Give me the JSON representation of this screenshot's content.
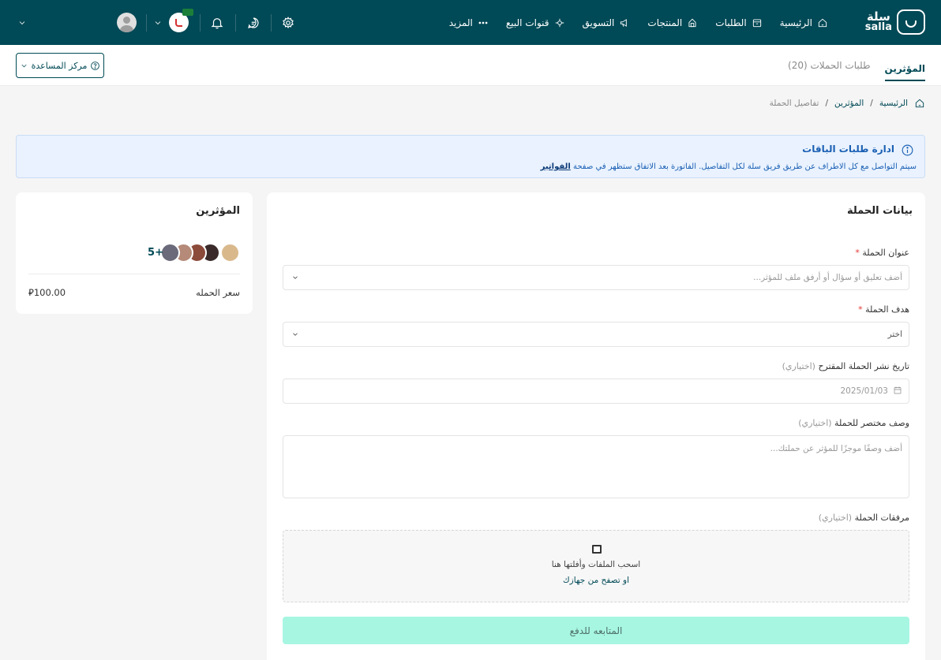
{
  "brand": {
    "name_ar": "سلة",
    "name_en": "salla"
  },
  "nav": {
    "items": [
      {
        "label": "الرئيسية",
        "icon": "home-icon"
      },
      {
        "label": "الطلبات",
        "icon": "orders-icon"
      },
      {
        "label": "المنتجات",
        "icon": "products-icon"
      },
      {
        "label": "التسويق",
        "icon": "megaphone-icon"
      },
      {
        "label": "قنوات البيع",
        "icon": "channels-icon"
      },
      {
        "label": "المزيد",
        "icon": "more-dots-icon"
      }
    ]
  },
  "subheader": {
    "tabs": [
      {
        "label": "المؤثرين",
        "active": true
      },
      {
        "label": "طلبات الحملات (20)",
        "active": false
      }
    ],
    "help_label": "مركز المساعدة"
  },
  "breadcrumb": {
    "home": "الرئيسية",
    "section": "المؤثرين",
    "current": "تفاصيل الحملة",
    "separator": "/"
  },
  "alert": {
    "title": "ادارة طلبات الباقات",
    "text": "سيتم التواصل مع كل الاطراف عن طريق فريق سلة لكل التفاصيل. الفاتورة بعد الاتفاق ستظهر في صفحة",
    "link": "الفواتير"
  },
  "form": {
    "title": "بيانات الحملة",
    "campaign_title": {
      "label": "عنوان الحملة",
      "required": "*",
      "placeholder": "أضف تعليق أو سؤال أو أرفق ملف للمؤثر..."
    },
    "campaign_goal": {
      "label": "هدف الحملة",
      "required": "*",
      "value": "اختر"
    },
    "publish_date": {
      "label": "تاريخ نشر الحملة المقترح",
      "optional": "(اختياري)",
      "value": "2025/01/03"
    },
    "description": {
      "label": "وصف مختصر للحملة",
      "optional": "(اختياري)",
      "placeholder": "أضف وصفًا موجزًا للمؤثر عن حملتك..."
    },
    "attachments": {
      "label": "مرفقات الحملة",
      "optional": "(اختياري)",
      "drag_text": "اسحب الملفات وأفلتها هنا",
      "browse_text": "او تصفح من جهازك"
    },
    "submit_label": "المتابعه للدفع"
  },
  "influencers": {
    "title": "المؤثرين",
    "more_count": "+5",
    "price_label": "سعر الحمله",
    "price_value": "⃁100.00",
    "avatar_colors": [
      "#d9b98c",
      "#3a2a2a",
      "#8c4a3a",
      "#b58a78",
      "#6a6a7a"
    ]
  },
  "colors": {
    "primary": "#004956",
    "accent": "#a7f6e2",
    "info_bg": "#e9f2fe",
    "info_text": "#1a5fb4"
  }
}
